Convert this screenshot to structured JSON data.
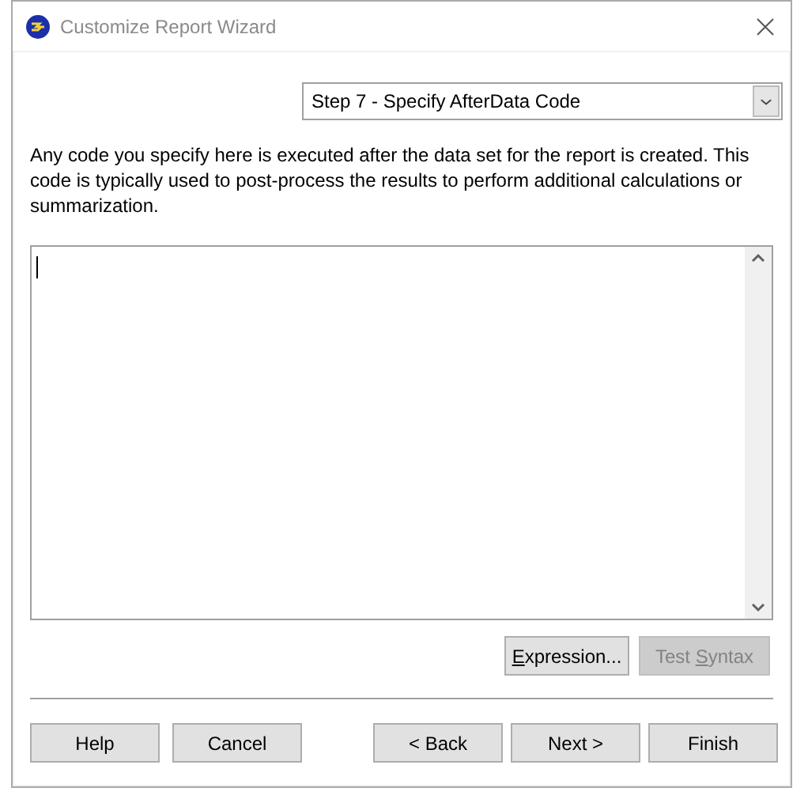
{
  "window": {
    "title": "Customize Report Wizard"
  },
  "step_dropdown": {
    "value": "Step 7 - Specify AfterData Code"
  },
  "description": "Any code you specify here is executed after the data set for the report is created. This code is typically used to post-process the results to perform additional calculations or summarization.",
  "tool_buttons": [
    {
      "mnemonic": "E",
      "after": "xpression...",
      "disabled": false
    },
    {
      "before": "Test ",
      "mnemonic": "S",
      "after": "yntax",
      "disabled": true
    }
  ],
  "nav_left": [
    "Help",
    "Cancel"
  ],
  "nav_right": [
    "< Back",
    "Next >",
    "Finish"
  ]
}
